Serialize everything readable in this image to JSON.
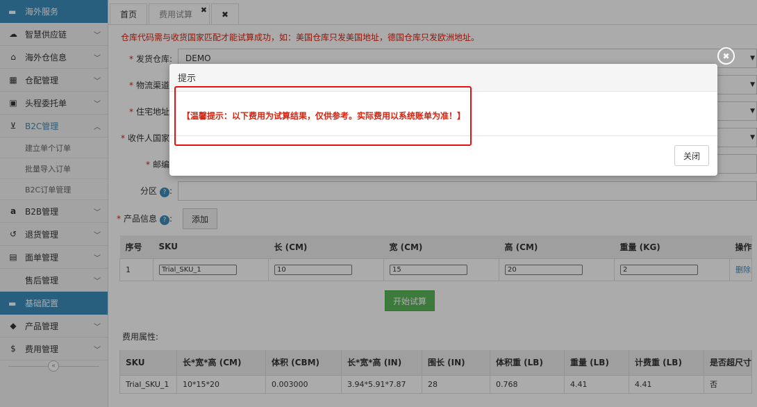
{
  "sidebar": {
    "groups": [
      {
        "title": "海外服务",
        "icon": "folder-icon"
      },
      {
        "title": "基础配置",
        "icon": "folder-icon"
      }
    ],
    "items": [
      {
        "label": "智慧供应链",
        "icon": "cloud-icon"
      },
      {
        "label": "海外仓信息",
        "icon": "home-icon"
      },
      {
        "label": "仓配管理",
        "icon": "grid-icon"
      },
      {
        "label": "头程委托单",
        "icon": "briefcase-icon"
      },
      {
        "label": "B2C管理",
        "icon": "cart-icon"
      },
      {
        "label": "B2B管理",
        "icon": "amazon-icon"
      },
      {
        "label": "退货管理",
        "icon": "undo-icon"
      },
      {
        "label": "面单管理",
        "icon": "document-icon"
      },
      {
        "label": "售后管理",
        "icon": "blank-icon"
      },
      {
        "label": "产品管理",
        "icon": "tag-icon"
      },
      {
        "label": "费用管理",
        "icon": "dollar-icon"
      }
    ],
    "subitems": [
      "建立单个订单",
      "批量导入订单",
      "B2C订单管理"
    ],
    "collapse_glyph": "«"
  },
  "tabs": [
    {
      "label": "首页"
    },
    {
      "label": "费用试算"
    }
  ],
  "tab_close_glyph": "✖",
  "notice": "仓库代码需与收货国家匹配才能试算成功，如：美国仓库只发美国地址，德国仓库只发欧洲地址。",
  "form": {
    "warehouse_label": "发货仓库:",
    "warehouse_value": "DEMO",
    "channel_label": "物流渠道:",
    "address_label": "住宅地址:",
    "country_label": "收件人国家:",
    "zip_label": "邮编:",
    "zone_label": "分区",
    "product_label": "产品信息",
    "add_button": "添加",
    "help_glyph": "?"
  },
  "product_table": {
    "headers": [
      "序号",
      "SKU",
      "长 (CM)",
      "宽 (CM)",
      "高 (CM)",
      "重量 (KG)",
      "操作"
    ],
    "row": {
      "index": "1",
      "sku": "Trial_SKU_1",
      "length": "10",
      "width": "15",
      "height": "20",
      "weight": "2",
      "action": "删除"
    }
  },
  "calc_button": "开始试算",
  "fee_label": "费用属性:",
  "fee_table": {
    "headers": [
      "SKU",
      "长*宽*高 (CM)",
      "体积 (CBM)",
      "长*宽*高 (IN)",
      "围长 (IN)",
      "体积重 (LB)",
      "重量 (LB)",
      "计费重 (LB)",
      "是否超尺寸"
    ],
    "row": [
      "Trial_SKU_1",
      "10*15*20",
      "0.003000",
      "3.94*5.91*7.87",
      "28",
      "0.768",
      "4.41",
      "4.41",
      "否"
    ]
  },
  "modal": {
    "title": "提示",
    "message": "【温馨提示：以下费用为试算结果，仅供参考。实际费用以系统账单为准！】",
    "close_button": "关闭"
  },
  "colors": {
    "accent": "#3c8dbc",
    "danger": "#d9230f",
    "success": "#5cb85c",
    "highlight": "#e8100c"
  }
}
